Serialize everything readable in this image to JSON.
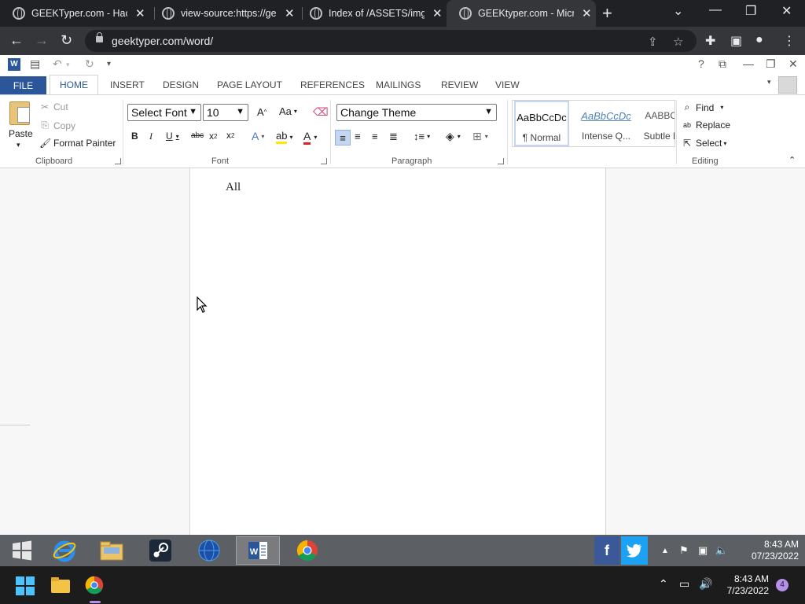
{
  "browser": {
    "tabs": [
      {
        "title": "GEEKTyper.com - Hack",
        "active": false
      },
      {
        "title": "view-source:https://ge",
        "active": false
      },
      {
        "title": "Index of /ASSETS/img",
        "active": false
      },
      {
        "title": "GEEKtyper.com - Micro",
        "active": true
      }
    ],
    "url": "geektyper.com/word/"
  },
  "ribbon": {
    "tabs": [
      "FILE",
      "HOME",
      "INSERT",
      "DESIGN",
      "PAGE LAYOUT",
      "REFERENCES",
      "MAILINGS",
      "REVIEW",
      "VIEW"
    ],
    "clipboard": {
      "paste": "Paste",
      "cut": "Cut",
      "copy": "Copy",
      "format_painter": "Format Painter",
      "label": "Clipboard"
    },
    "font": {
      "font_select": "Select Font",
      "size_select": "10",
      "label": "Font"
    },
    "paragraph": {
      "theme_select": "Change Theme",
      "label": "Paragraph"
    },
    "styles": [
      {
        "preview": "AaBbCcDc",
        "name": "¶ Normal"
      },
      {
        "preview": "AaBbCcDc",
        "name": "Intense Q..."
      },
      {
        "preview": "AABBCC",
        "name": "Subtle Re"
      }
    ],
    "editing": {
      "find": "Find",
      "replace": "Replace",
      "select": "Select",
      "label": "Editing"
    }
  },
  "document": {
    "text": "All"
  },
  "inner_taskbar": {
    "time": "8:43 AM",
    "date": "07/23/2022"
  },
  "taskbar": {
    "time": "8:43 AM",
    "date": "7/23/2022",
    "notification_count": "4"
  }
}
